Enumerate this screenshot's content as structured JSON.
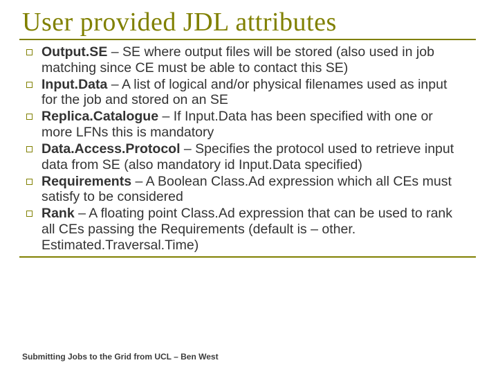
{
  "title": "User provided JDL attributes",
  "bullets": [
    {
      "term": "Output.SE",
      "desc": " – SE where output files will be stored (also used in job matching since CE must be able to contact this SE)"
    },
    {
      "term": "Input.Data",
      "desc": " – A list of logical and/or physical filenames used as input for the job and stored on an SE"
    },
    {
      "term": "Replica.Catalogue",
      "desc": " – If Input.Data has been specified with one or more LFNs this is mandatory"
    },
    {
      "term": "Data.Access.Protocol",
      "desc": " – Specifies the protocol used to retrieve input data from SE (also mandatory id Input.Data specified)"
    },
    {
      "term": "Requirements",
      "desc": " – A Boolean Class.Ad expression which all CEs must satisfy to be considered"
    },
    {
      "term": "Rank",
      "desc": " – A floating point Class.Ad expression that can be used to rank all CEs passing the Requirements (default is – other. Estimated.Traversal.Time)"
    }
  ],
  "footer": "Submitting Jobs to the Grid from UCL – Ben West"
}
